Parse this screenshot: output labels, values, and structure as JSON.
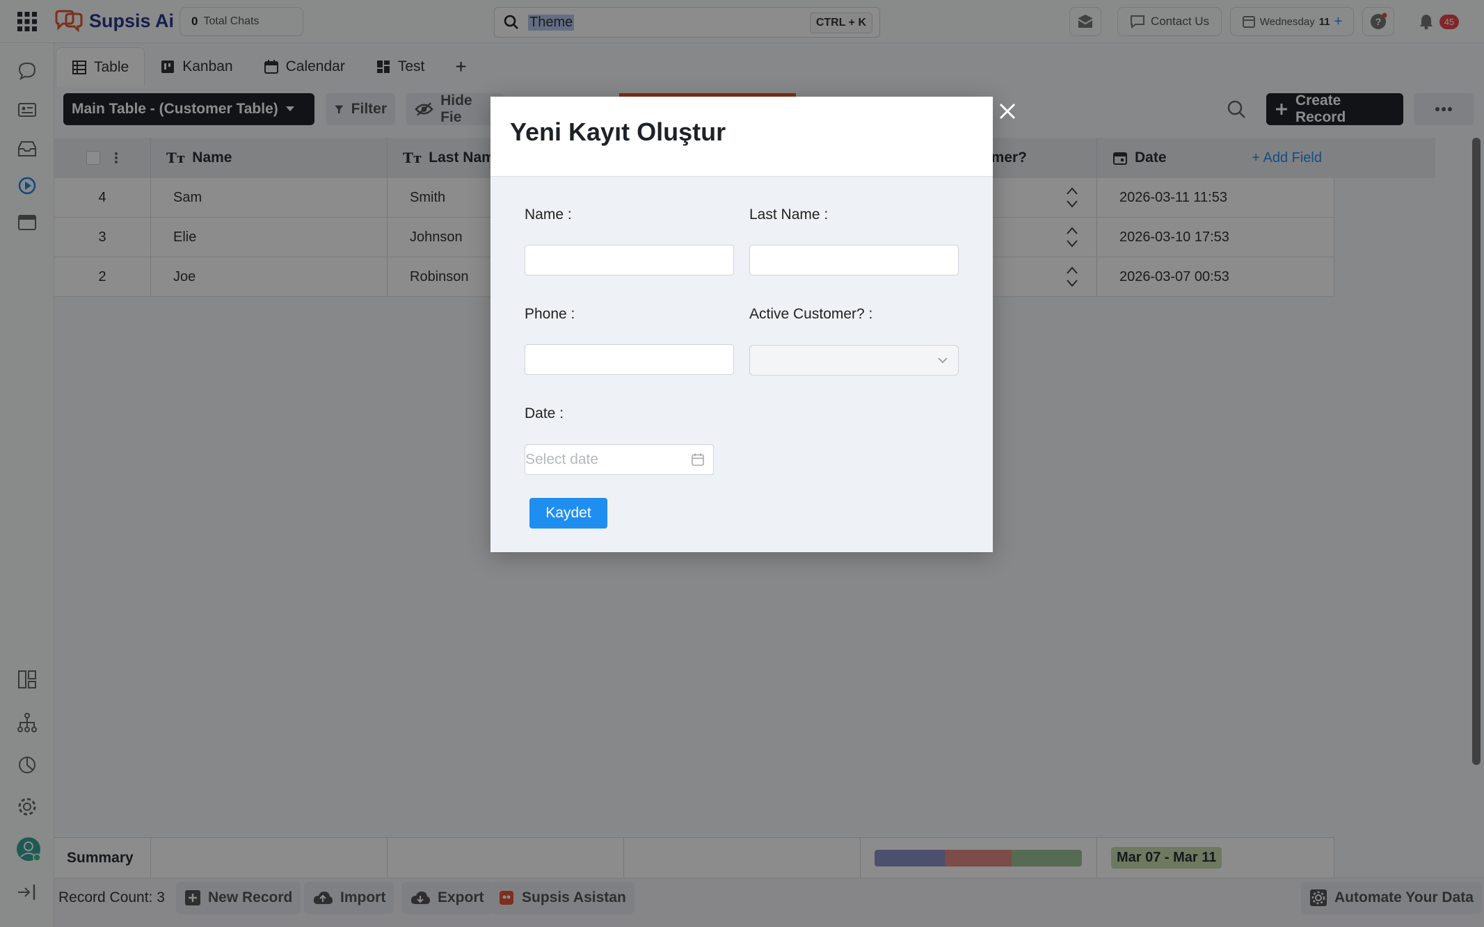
{
  "app": {
    "name": "Supsis Ai"
  },
  "topbar": {
    "total_chats_count": "0",
    "total_chats_label": "Total Chats",
    "search_value": "Theme",
    "search_shortcut": "CTRL + K",
    "contact_label": "Contact Us",
    "day_label": "Wednesday",
    "day_number": "11",
    "notification_count": "45"
  },
  "tabs": [
    {
      "label": "Table",
      "icon": "table-icon"
    },
    {
      "label": "Kanban",
      "icon": "kanban-icon"
    },
    {
      "label": "Calendar",
      "icon": "calendar-icon"
    },
    {
      "label": "Test",
      "icon": "dashboard-icon"
    }
  ],
  "toolbar": {
    "table_select": "Main Table - (Customer Table)",
    "filter_label": "Filter",
    "hide_fields_label": "Hide Fie",
    "create_record_label": "Create Record"
  },
  "table": {
    "headers": {
      "name": "Name",
      "last_name": "Last Nam",
      "active": "mer?",
      "date": "Date",
      "add_field": "+ Add Field"
    },
    "rows": [
      {
        "id": "4",
        "name": "Sam",
        "last_name": "Smith",
        "date": "2026-03-11 11:53"
      },
      {
        "id": "3",
        "name": "Elie",
        "last_name": "Johnson",
        "date": "2026-03-10 17:53"
      },
      {
        "id": "2",
        "name": "Joe",
        "last_name": "Robinson",
        "date": "2026-03-07 00:53"
      }
    ],
    "summary_label": "Summary",
    "date_range": "Mar 07 - Mar 11"
  },
  "footer": {
    "record_count": "Record Count: 3",
    "new_record": "New Record",
    "import": "Import",
    "export": "Export",
    "assistant": "Supsis Asistan",
    "automate": "Automate Your Data"
  },
  "modal": {
    "title": "Yeni Kayıt Oluştur",
    "name_label": "Name :",
    "last_name_label": "Last Name :",
    "phone_label": "Phone :",
    "active_label": "Active Customer? :",
    "date_label": "Date :",
    "date_placeholder": "Select date",
    "save_label": "Kaydet"
  },
  "colors": {
    "accent": "#1f8ef1",
    "dark_button": "#1f2328",
    "badge": "#e5484d",
    "range_badge": "#c9ddb0"
  }
}
